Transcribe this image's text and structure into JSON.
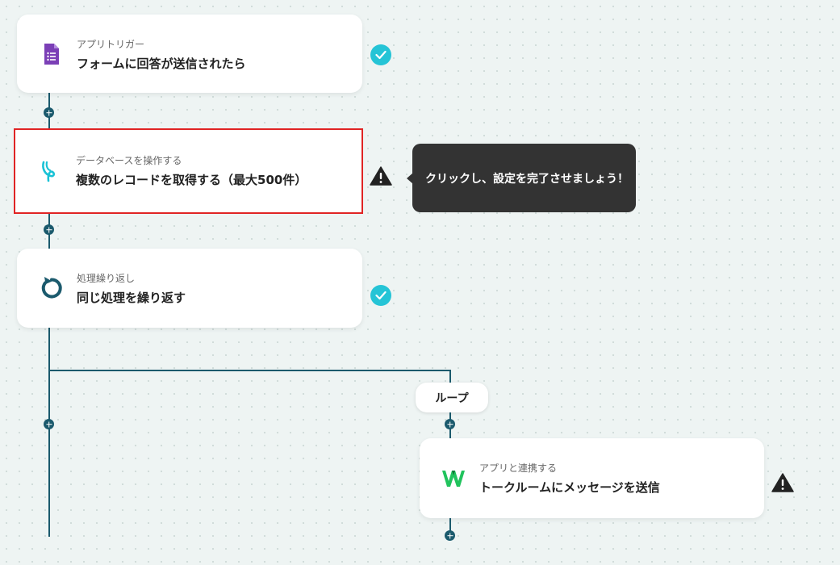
{
  "nodes": [
    {
      "sub": "アプリトリガー",
      "title": "フォームに回答が送信されたら",
      "icon": "google-forms-icon",
      "status": "complete"
    },
    {
      "sub": "データベースを操作する",
      "title": "複数のレコードを取得する（最大500件）",
      "icon": "database-icon",
      "status": "warning"
    },
    {
      "sub": "処理繰り返し",
      "title": "同じ処理を繰り返す",
      "icon": "loop-icon",
      "status": "complete"
    },
    {
      "sub": "アプリと連携する",
      "title": "トークルームにメッセージを送信",
      "icon": "chat-app-icon",
      "status": "warning"
    }
  ],
  "tooltip": "クリックし、設定を完了させましょう！",
  "loop_label": "ループ",
  "colors": {
    "line": "#1b5a6d",
    "check": "#25c4d6",
    "selected_border": "#e02424",
    "tooltip_bg": "#333333"
  }
}
